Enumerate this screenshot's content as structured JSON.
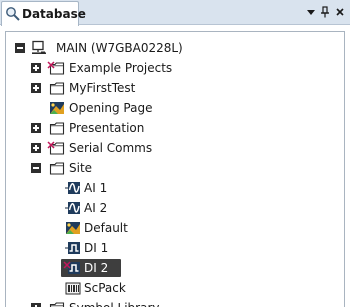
{
  "window": {
    "tab_title": "Database",
    "buttons": [
      "dropdown",
      "pin",
      "close"
    ]
  },
  "colors": {
    "header_bg": "#d9e3ee",
    "selection_bg": "#3e3e3e",
    "error_mark": "#c2185b"
  },
  "tree": [
    {
      "label": "MAIN (W7GBA0228L)",
      "icon": "computer-icon",
      "toggle": "expanded",
      "level": 0
    },
    {
      "label": "Example Projects",
      "icon": "folder-icon",
      "toggle": "collapsed",
      "level": 1,
      "error": true
    },
    {
      "label": "MyFirstTest",
      "icon": "folder-icon",
      "toggle": "collapsed",
      "level": 1
    },
    {
      "label": "Opening Page",
      "icon": "mimic-icon",
      "toggle": "none",
      "level": 1
    },
    {
      "label": "Presentation",
      "icon": "folder-icon",
      "toggle": "collapsed",
      "level": 1
    },
    {
      "label": "Serial Comms",
      "icon": "folder-icon",
      "toggle": "collapsed",
      "level": 1,
      "error": true
    },
    {
      "label": "Site",
      "icon": "folder-icon",
      "toggle": "expanded",
      "level": 1
    },
    {
      "label": "AI 1",
      "icon": "analog-point-icon",
      "toggle": "none",
      "level": 2
    },
    {
      "label": "AI 2",
      "icon": "analog-point-icon",
      "toggle": "none",
      "level": 2
    },
    {
      "label": "Default",
      "icon": "mimic-icon",
      "toggle": "none",
      "level": 2
    },
    {
      "label": "DI 1",
      "icon": "digital-point-icon",
      "toggle": "none",
      "level": 2
    },
    {
      "label": "DI 2",
      "icon": "digital-point-icon",
      "toggle": "none",
      "level": 2,
      "selected": true,
      "error": true
    },
    {
      "label": "ScPack",
      "icon": "package-icon",
      "toggle": "none",
      "level": 2
    },
    {
      "label": "Symbol Library",
      "icon": "folder-icon",
      "toggle": "collapsed",
      "level": 1
    }
  ]
}
